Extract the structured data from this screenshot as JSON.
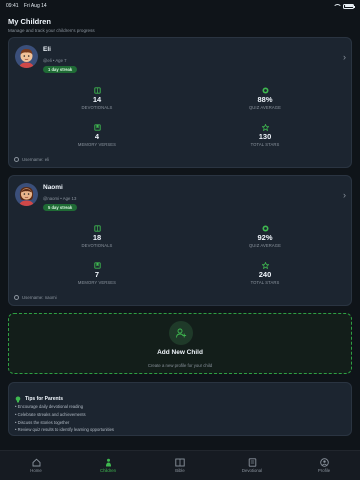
{
  "status_bar": {
    "time": "09:41",
    "date": "Fri Aug 14"
  },
  "header": {
    "title": "My Children",
    "subtitle": "Manage and track your children's progress"
  },
  "children": [
    {
      "name": "Eli",
      "meta": "@eli • Age 7",
      "streak": "1 day streak",
      "stats": [
        {
          "icon": "book-icon",
          "value": "14",
          "label": "DEVOTIONALS"
        },
        {
          "icon": "target-icon",
          "value": "88%",
          "label": "QUIZ AVERAGE"
        },
        {
          "icon": "bookmark-icon",
          "value": "4",
          "label": "MEMORY VERSES"
        },
        {
          "icon": "star-icon",
          "value": "130",
          "label": "TOTAL STARS"
        }
      ],
      "username": "Username: eli"
    },
    {
      "name": "Naomi",
      "meta": "@naomi • Age 13",
      "streak": "5 day streak",
      "stats": [
        {
          "icon": "book-icon",
          "value": "18",
          "label": "DEVOTIONALS"
        },
        {
          "icon": "target-icon",
          "value": "92%",
          "label": "QUIZ AVERAGE"
        },
        {
          "icon": "bookmark-icon",
          "value": "7",
          "label": "MEMORY VERSES"
        },
        {
          "icon": "star-icon",
          "value": "240",
          "label": "TOTAL STARS"
        }
      ],
      "username": "Username: naomi"
    }
  ],
  "add_child": {
    "title": "Add New Child",
    "subtitle": "Create a new profile for your child"
  },
  "tips": {
    "title": "Tips for Parents",
    "items": [
      "• Encourage daily devotional reading",
      "• Celebrate streaks and achievements",
      "• Discuss the stories together",
      "• Review quiz results to identify learning opportunities"
    ]
  },
  "tabs": [
    {
      "label": "Home",
      "icon": "home-icon",
      "active": false
    },
    {
      "label": "Children",
      "icon": "children-icon",
      "active": true
    },
    {
      "label": "Bible",
      "icon": "bible-icon",
      "active": false
    },
    {
      "label": "Devotional",
      "icon": "devotional-icon",
      "active": false
    },
    {
      "label": "Profile",
      "icon": "profile-icon",
      "active": false
    }
  ],
  "colors": {
    "accent": "#3fb950",
    "background": "#0f1419",
    "card": "#1c2530",
    "badge": "#1f6b35"
  }
}
